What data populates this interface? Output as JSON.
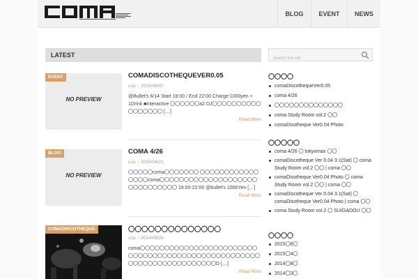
{
  "header": {
    "logo_alt": "coma",
    "nav": [
      "BLOG",
      "EVENT",
      "NEWS"
    ]
  },
  "main": {
    "section_title": "LATEST",
    "read_more": "Read More",
    "no_preview": "NO PREVIEW",
    "posts": [
      {
        "category": "EVENT",
        "title": "COMADISCOTHEQUEVER0.05",
        "author": "coa",
        "date": "2015/06/07",
        "excerpt": "@Bullet's 6/14 Start 18:00 / End 22:00 Charge:1000yen + 1Drink ■interactive 〇〇〇〇〇〇a2 DJ〇〇〇〇〇〇〇〇〇〇〇〇〇〇〇〇〇 […]"
      },
      {
        "category": "BLOG",
        "title": "COMA 4/26",
        "author": "coa",
        "date": "2015/04/21",
        "excerpt": "〇〇〇〇〇coma〇〇〇〇〇〇〇 〇〇〇〇〇〇〇〇〇〇〇〇 〇〇〇〇coma〇〇〇〇〇〇〇〇〇〇〇〇〇〇〇〇〇〇〇〇〇〇〇〇〇〇〇〇〇〇 18:00-22:00 @bullet's 1000Yen […]"
      },
      {
        "category": "COMADISCOTHEQUE",
        "title": "〇〇〇〇〇〇〇〇〇〇〇〇〇〇",
        "author": "coa",
        "date": "2014/08/26",
        "excerpt": "coma〇〇〇〇〇〇〇〇〇〇〇〇〇〇〇〇〇〇〇〇〇〇〇〇〇〇〇〇〇〇〇〇〇〇〇〇〇〇〇〇〇〇〇〇〇〇〇〇〇〇〇〇〇〇〇〇〇〇〇〇〇〇〇〇〇〇〇〇〇D […]"
      }
    ]
  },
  "sidebar": {
    "search_placeholder": "Search the site",
    "recent_posts_title": "〇〇〇〇",
    "recent_posts": [
      "comaDiscothequeVer0.05",
      "coma 4/26",
      "〇〇〇〇〇〇〇〇〇〇〇〇〇〇",
      "coma Study Room vol.2 〇〇",
      "comaDisotheque Ver0.04 Photo"
    ],
    "recent_comments_title": "〇〇〇〇〇",
    "recent_comments": [
      "coma 4/26 〇 tokyomax 〇〇",
      "comaDiscotheque Ver 0.04 3.1(Sat) 〇 coma Study Room vol.2 〇〇 | coma 〇〇",
      "comaDisotheque Ver0.04 Photo 〇 coma Study Room vol.2 〇〇 | coma 〇〇",
      "comaDiscotheque Ver 0.04 3.1(Sat) 〇 comaDisotheque Ver0.04 Photo | coma 〇〇",
      "coma Study Room vol.2 〇 SUIGADOU 〇〇"
    ],
    "archives_title": "〇〇〇〇",
    "archives": [
      "2015〇6〇",
      "2015〇4〇",
      "2014〇8〇",
      "2014〇3〇"
    ]
  },
  "colors": {
    "accent": "#d6a16b",
    "link": "#d49a5a",
    "bar": "#dedede"
  }
}
